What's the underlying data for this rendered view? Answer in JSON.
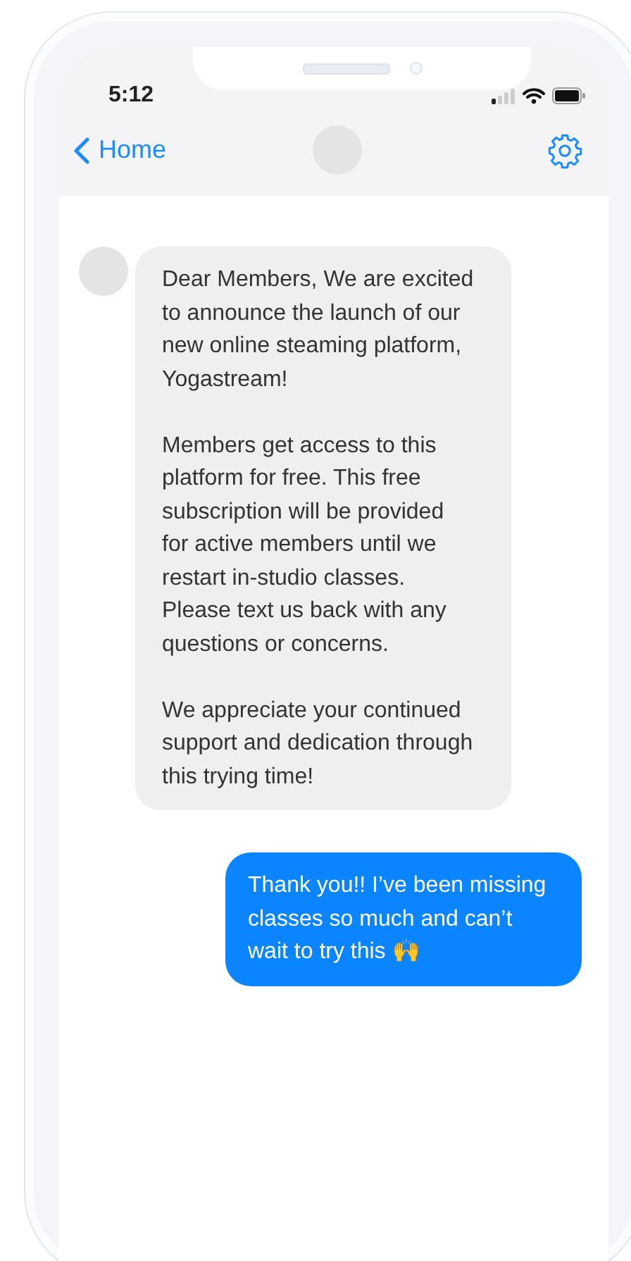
{
  "status_bar": {
    "time": "5:12"
  },
  "nav": {
    "back_label": "Home"
  },
  "messages": [
    {
      "kind": "incoming",
      "paragraphs": [
        "Dear Members, We are excited to announce the launch of our new online steaming platform, Yogastream!",
        "Members get access to this platform for free. This free subscription will be provided for active members until we restart in-studio classes. Please text us back with any questions or concerns.",
        "We appreciate your continued support and dedication through this trying time!"
      ]
    },
    {
      "kind": "outgoing",
      "paragraphs": [
        "Thank you!! I’ve been missing classes so much and can’t wait to try this 🙌"
      ]
    }
  ]
}
